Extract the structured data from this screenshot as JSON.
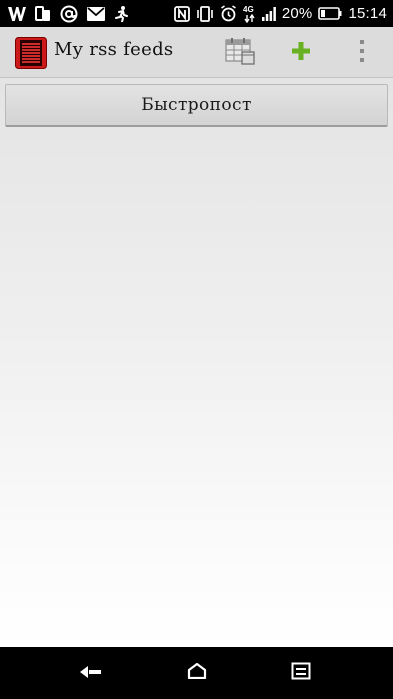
{
  "status_bar": {
    "battery_percent": "20%",
    "time": "15:14",
    "network_type": "4G",
    "left_icons": [
      "w-app-icon",
      "dual-sim-icon",
      "at-sign-icon",
      "mail-icon",
      "running-person-icon"
    ],
    "right_icons": [
      "nfc-icon",
      "vibrate-icon",
      "alarm-icon",
      "network-4g-icon",
      "signal-icon",
      "battery-icon"
    ]
  },
  "action_bar": {
    "title": "My rss feeds",
    "app_icon": "rss-feed-app-icon",
    "actions": [
      "calendar-icon",
      "add-icon",
      "overflow-menu-icon"
    ],
    "accent_color": "#6ab023"
  },
  "feeds": [
    {
      "label": "Быстропост"
    }
  ],
  "nav_bar": {
    "buttons": [
      "back-icon",
      "home-icon",
      "recents-icon"
    ]
  }
}
